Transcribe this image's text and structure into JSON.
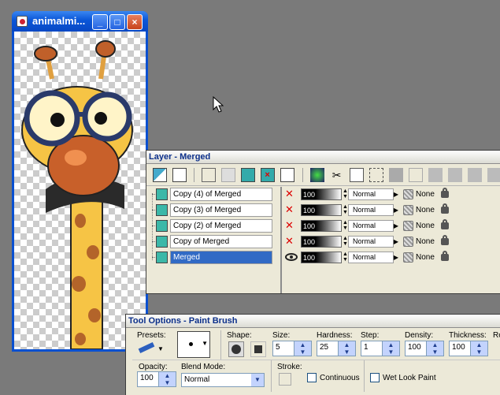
{
  "image_window": {
    "title": "animalmi...",
    "minimize_glyph": "_",
    "maximize_glyph": "□",
    "close_glyph": "×"
  },
  "layer_palette": {
    "title": "Layer - Merged",
    "layers": [
      {
        "name": "Copy (4) of Merged",
        "opacity": "100",
        "blend_mode": "Normal",
        "mask": "None",
        "visible": false,
        "selected": false
      },
      {
        "name": "Copy (3) of Merged",
        "opacity": "100",
        "blend_mode": "Normal",
        "mask": "None",
        "visible": false,
        "selected": false
      },
      {
        "name": "Copy (2) of Merged",
        "opacity": "100",
        "blend_mode": "Normal",
        "mask": "None",
        "visible": false,
        "selected": false
      },
      {
        "name": "Copy of Merged",
        "opacity": "100",
        "blend_mode": "Normal",
        "mask": "None",
        "visible": false,
        "selected": false
      },
      {
        "name": "Merged",
        "opacity": "100",
        "blend_mode": "Normal",
        "mask": "None",
        "visible": true,
        "selected": true
      }
    ]
  },
  "tool_options": {
    "title": "Tool Options - Paint Brush",
    "presets_label": "Presets:",
    "shape_label": "Shape:",
    "size_label": "Size:",
    "size_value": "5",
    "hardness_label": "Hardness:",
    "hardness_value": "25",
    "step_label": "Step:",
    "step_value": "1",
    "density_label": "Density:",
    "density_value": "100",
    "thickness_label": "Thickness:",
    "thickness_value": "100",
    "rotation_label": "Ro",
    "opacity_label": "Opacity:",
    "opacity_value": "100",
    "blend_mode_label": "Blend Mode:",
    "blend_mode_value": "Normal",
    "stroke_label": "Stroke:",
    "continuous_label": "Continuous",
    "wet_look_label": "Wet Look Paint"
  },
  "colors": {
    "desktop": "#7a7a7a",
    "xp_blue": "#0a50d0",
    "selection": "#316ac5",
    "panel_bg": "#ece9d8"
  }
}
